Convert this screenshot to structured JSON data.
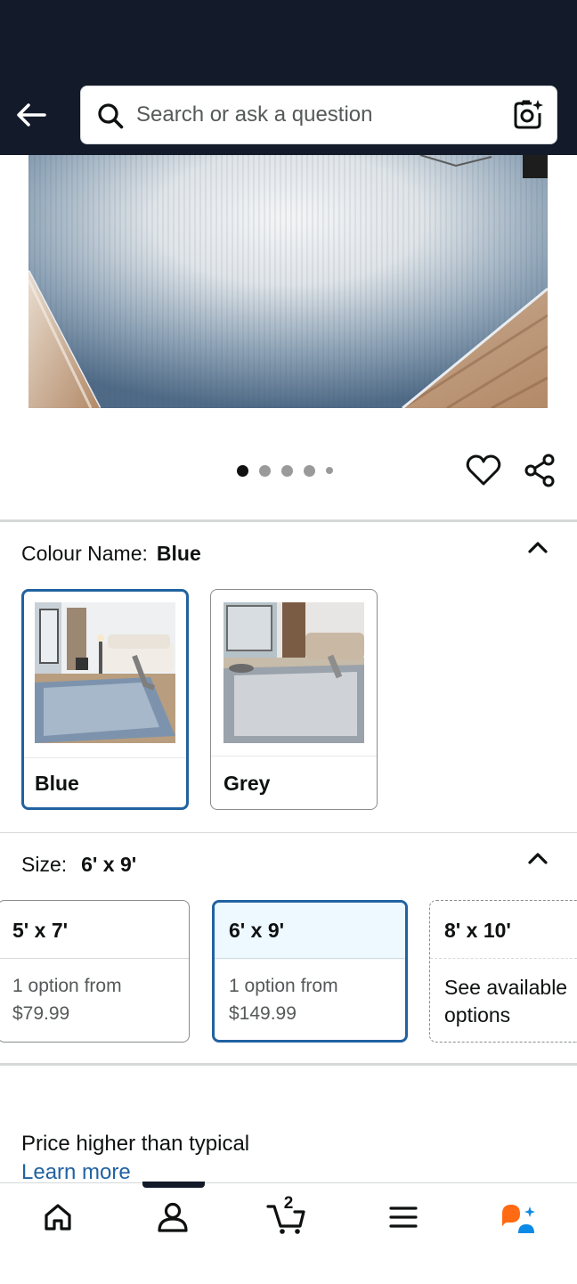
{
  "header": {
    "search_placeholder": "Search or ask a question"
  },
  "carousel": {
    "total_images": 5,
    "active_index": 0
  },
  "colour": {
    "label": "Colour Name:",
    "selected_value": "Blue",
    "options": [
      {
        "name": "Blue",
        "selected": true
      },
      {
        "name": "Grey",
        "selected": false
      }
    ]
  },
  "size": {
    "label": "Size:",
    "selected_value": "6' x 9'",
    "options": [
      {
        "label": "5' x 7'",
        "line1": "1 option from",
        "line2": "$79.99",
        "selected": false
      },
      {
        "label": "6' x 9'",
        "line1": "1 option from",
        "line2": "$149.99",
        "selected": true
      },
      {
        "label": "8' x 10'",
        "line1": "See available",
        "line2": "options",
        "selected": false
      }
    ]
  },
  "price_note": {
    "text": "Price higher than typical",
    "link": "Learn more"
  },
  "bottom_nav": {
    "cart_count": "2",
    "items": [
      "home",
      "account",
      "cart",
      "menu",
      "rufus"
    ]
  },
  "colors": {
    "header_bg": "#131a29",
    "selected_border": "#2162a1",
    "link": "#2162a1",
    "rufus_orange": "#ff6a13",
    "rufus_blue": "#0b8ae6"
  }
}
